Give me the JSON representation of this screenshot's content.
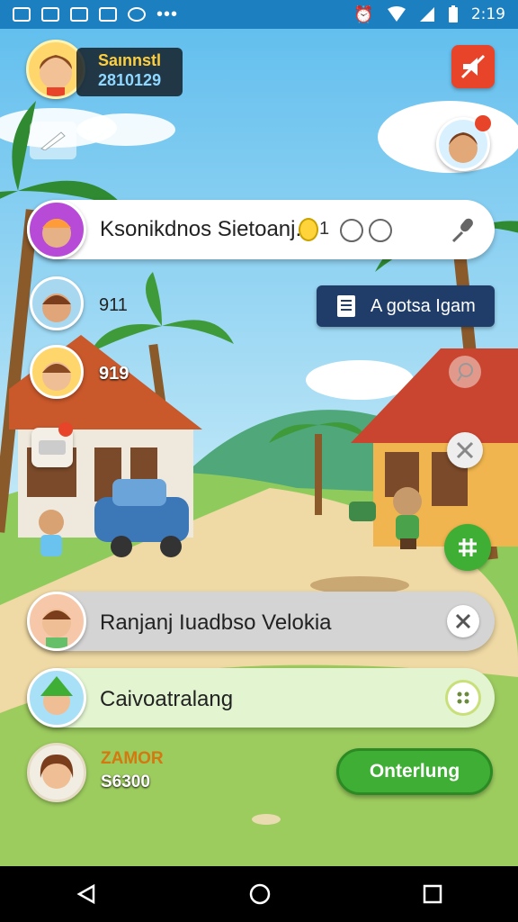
{
  "status_bar": {
    "time": "2:19"
  },
  "player": {
    "name": "Saınnstl",
    "coins": "2810129"
  },
  "top_bar": {
    "name": "Ksonikdnos Sietoanj.",
    "count": "1"
  },
  "side_list": [
    {
      "value": "911"
    },
    {
      "value": "919"
    }
  ],
  "action_button": {
    "label": "A gotsa Igam"
  },
  "list_items": [
    {
      "label": "Ranjanj Iuadbso Velokia"
    },
    {
      "label": "Caivoatralang"
    }
  ],
  "bottom": {
    "line1": "ZAMOR",
    "line2": "S6300",
    "button_label": "Onterlung"
  },
  "colors": {
    "accent_green": "#3fae34",
    "status_blue": "#1c7fbf",
    "alert_red": "#e8442a"
  }
}
